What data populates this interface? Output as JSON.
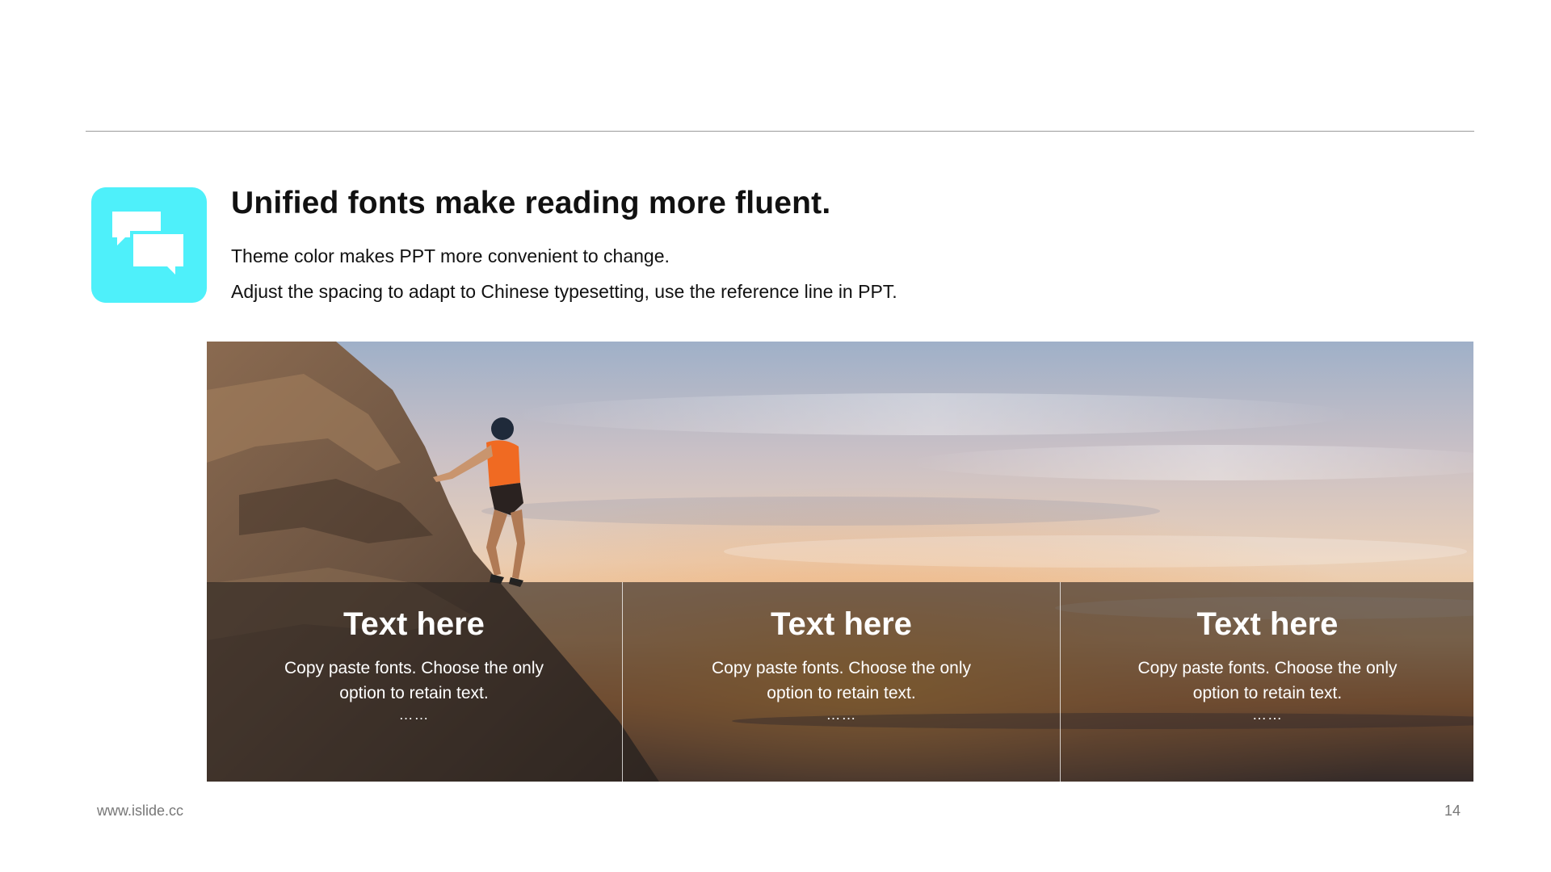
{
  "slide": {
    "heading": "Unified fonts make reading more fluent.",
    "subtitle_lines": [
      "Theme color makes PPT more convenient to change.",
      "Adjust the spacing to adapt to Chinese typesetting, use the reference line in PPT."
    ],
    "icon": "chat-bubbles-icon",
    "accent_color": "#4ef0fa"
  },
  "photo": {
    "subject": "rock-climber-at-sunset-image"
  },
  "panels": [
    {
      "title": "Text here",
      "text": "Copy paste fonts. Choose the only option to retain text.",
      "more": "……"
    },
    {
      "title": "Text here",
      "text": "Copy paste fonts. Choose the only option to retain text.",
      "more": "……"
    },
    {
      "title": "Text here",
      "text": "Copy paste fonts. Choose the only option to retain text.",
      "more": "……"
    }
  ],
  "footer": {
    "url": "www.islide.cc",
    "page_number": "14"
  }
}
